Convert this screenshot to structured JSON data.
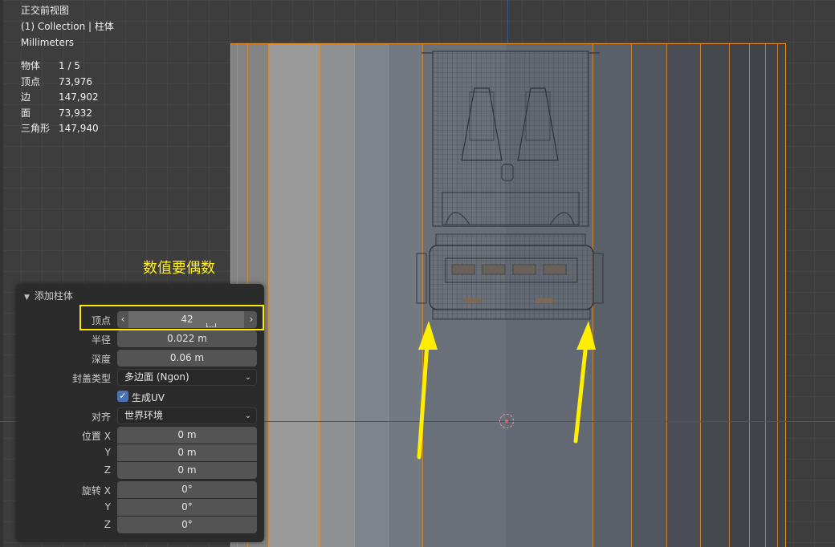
{
  "viewport": {
    "view_name": "正交前视图",
    "collection": "(1) Collection | 柱体",
    "units": "Millimeters",
    "stats": [
      {
        "key": "物体",
        "value": "1 / 5"
      },
      {
        "key": "顶点",
        "value": "73,976"
      },
      {
        "key": "边",
        "value": "147,902"
      },
      {
        "key": "面",
        "value": "73,932"
      },
      {
        "key": "三角形",
        "value": "147,940"
      }
    ]
  },
  "annotation": {
    "text": "数值要偶数",
    "color": "#ffee22"
  },
  "panel": {
    "title": "添加柱体",
    "vertices": {
      "label": "顶点",
      "value": "42"
    },
    "radius": {
      "label": "半径",
      "value": "0.022 m"
    },
    "depth": {
      "label": "深度",
      "value": "0.06 m"
    },
    "cap_type": {
      "label": "封盖类型",
      "value": "多边面 (Ngon)"
    },
    "generate_uv": {
      "label": "生成UV",
      "checked": true
    },
    "align": {
      "label": "对齐",
      "value": "世界环境"
    },
    "location": {
      "label": "位置",
      "x_label": "X",
      "y_label": "Y",
      "z_label": "Z",
      "x": "0 m",
      "y": "0 m",
      "z": "0 m"
    },
    "rotation": {
      "label": "旋转",
      "x_label": "X",
      "y_label": "Y",
      "z_label": "Z",
      "x": "0°",
      "y": "0°",
      "z": "0°"
    }
  },
  "colors": {
    "accent": "#4772b3",
    "selection_outline": "#e8922a",
    "highlight_box": "#ffe900",
    "arrow": "#ffee00"
  }
}
